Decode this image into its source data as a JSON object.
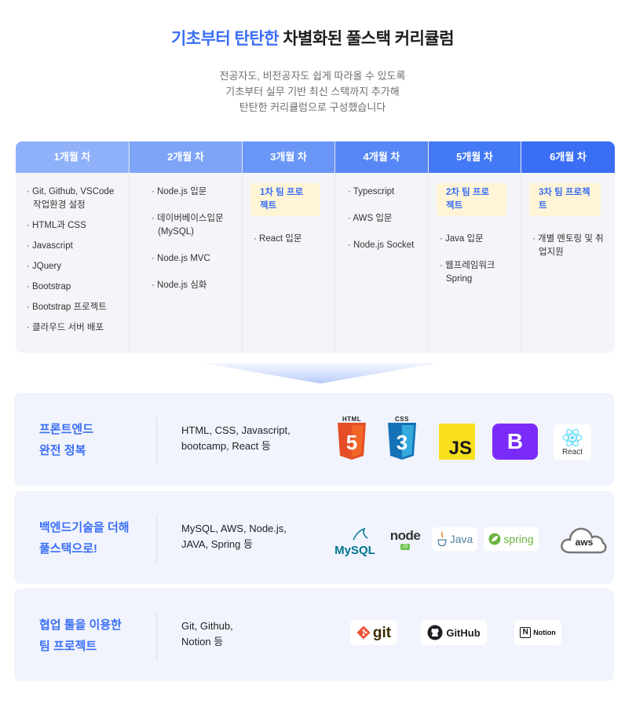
{
  "header": {
    "title_blue": "기초부터 탄탄한",
    "title_dark": "차별화된 풀스택 커리큘럼",
    "subtitle_lines": [
      "전공자도, 비전공자도 쉽게 따라올 수 있도록",
      "기초부터 실무 기반 최신 스택까지 추가해",
      "탄탄한 커리큘럼으로 구성했습니다"
    ]
  },
  "curriculum": [
    {
      "month": "1개월 차",
      "color": "#8fb1f9",
      "badge": "",
      "items": [
        "Git, Github, VSCode 작업환경 설정",
        "HTML과 CSS",
        "Javascript",
        "JQuery",
        "Bootstrap",
        "Bootstrap 프로젝트",
        "클라우드 서버 배포"
      ]
    },
    {
      "month": "2개월 차",
      "color": "#7ea4f8",
      "badge": "",
      "items": [
        "Node.js 입문",
        "데이버베이스입문 (MySQL)",
        "Node.js MVC",
        "Node.js 심화"
      ]
    },
    {
      "month": "3개월 차",
      "color": "#6a96f7",
      "badge": "1차 팀 프로젝트",
      "items": [
        "React 입문"
      ]
    },
    {
      "month": "4개월 차",
      "color": "#5787f6",
      "badge": "",
      "items": [
        "Typescript",
        "AWS 입문",
        "Node.js Socket"
      ]
    },
    {
      "month": "5개월 차",
      "color": "#4479f5",
      "badge": "2차 팀 프로젝트",
      "items": [
        "Java 입문",
        "웹프레임워크 Spring"
      ]
    },
    {
      "month": "6개월 차",
      "color": "#3a6ef5",
      "badge": "3차 팀 프로젝트",
      "items": [
        "개별 멘토링 및 취업지원"
      ]
    }
  ],
  "features": [
    {
      "title_lines": [
        "프론트엔드",
        "완전 정복"
      ],
      "desc_lines": [
        "HTML, CSS, Javascript,",
        "bootcamp, React 등"
      ],
      "logos": {
        "html5_label": "HTML",
        "css3_label": "CSS",
        "js_label": "JS",
        "bootstrap_label": "B",
        "react_label": "React"
      }
    },
    {
      "title_lines": [
        "백엔드기술을 더해",
        "풀스택으로!"
      ],
      "desc_lines": [
        "MySQL, AWS, Node.js,",
        "JAVA, Spring 등"
      ],
      "logos": {
        "mysql_label": "MySQL",
        "node_label": "node",
        "node_sub": "JS",
        "java_label": "Java",
        "spring_label": "spring",
        "aws_label": "aws"
      }
    },
    {
      "title_lines": [
        "협업 툴을 이용한",
        "팀 프로젝트"
      ],
      "desc_lines": [
        "Git, Github,",
        "Notion 등"
      ],
      "logos": {
        "git_label": "git",
        "github_label": "GitHub",
        "notion_label": "Notion",
        "notion_mark": "N"
      }
    }
  ],
  "colors": {
    "accent": "#3a6ef5",
    "badge_bg": "#fff5d6",
    "card_bg": "#f1f4fd"
  }
}
